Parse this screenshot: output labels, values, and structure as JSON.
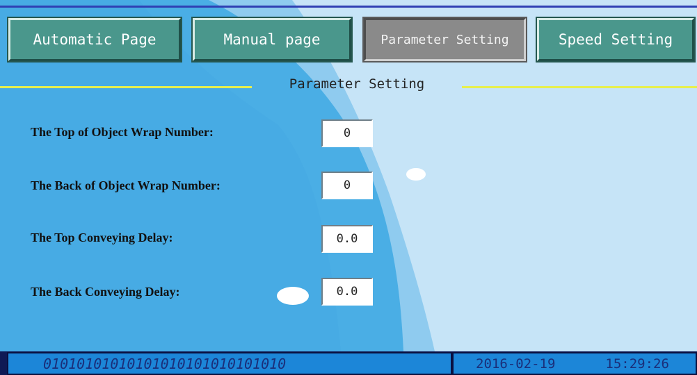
{
  "tabs": [
    {
      "label": "Automatic Page"
    },
    {
      "label": "Manual page"
    },
    {
      "label": "Parameter Setting",
      "active": true
    },
    {
      "label": "Speed Setting"
    }
  ],
  "section": {
    "title": "Parameter Setting"
  },
  "params": {
    "top_wrap_number": {
      "label": "The Top of Object Wrap Number:",
      "value": "0"
    },
    "back_wrap_number": {
      "label": "The Back of Object Wrap Number:",
      "value": "0"
    },
    "top_conveying_delay": {
      "label": "The Top Conveying Delay:",
      "value": "0.0"
    },
    "back_conveying_delay": {
      "label": "The Back Conveying Delay:",
      "value": "0.0"
    }
  },
  "status": {
    "binary": "01010101010101010101010101010",
    "date": "2016-02-19",
    "time": "15:29:26"
  },
  "colors": {
    "tab_bg": "#4a978c",
    "tab_active_bg": "#8a8a8a",
    "wave_dark": "#4aaee5",
    "wave_light": "#c6e4f7",
    "section_line": "#e7ef4d",
    "status_bg": "#1c86d8",
    "status_text": "#1a2f7a"
  }
}
